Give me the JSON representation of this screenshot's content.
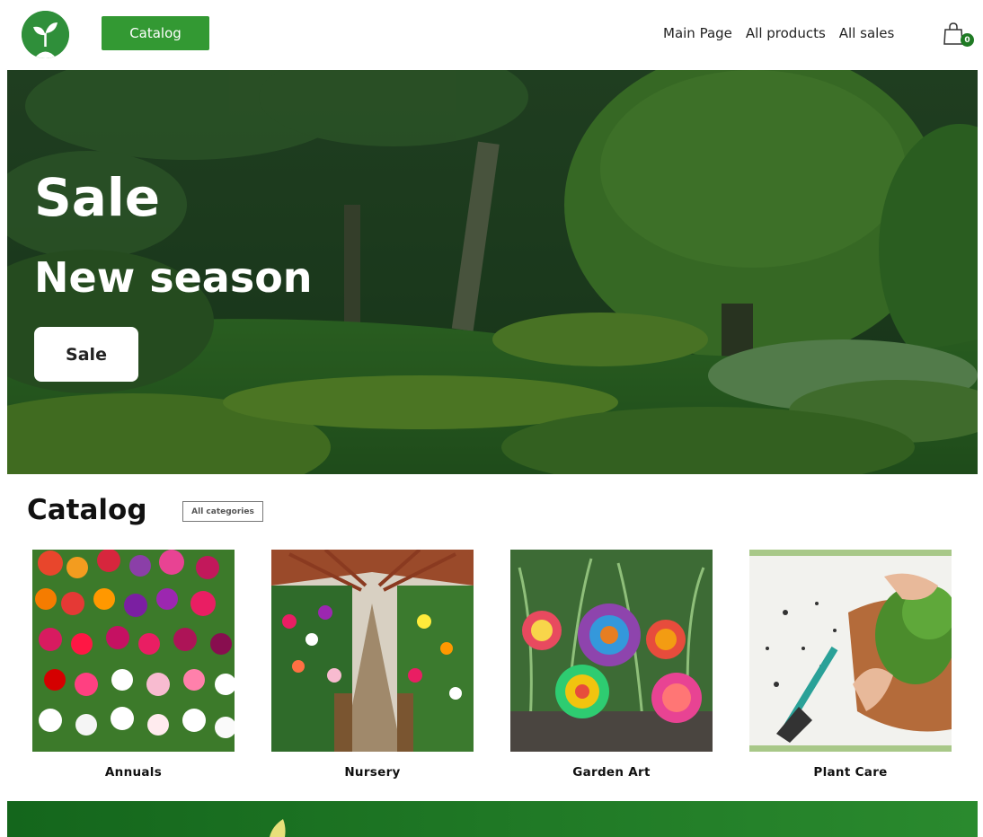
{
  "header": {
    "logo_icon": "sprout-icon",
    "catalog_button": "Catalog",
    "nav": [
      "Main Page",
      "All products",
      "All sales"
    ],
    "cart_icon": "shopping-bag-icon",
    "cart_count": "0"
  },
  "hero": {
    "title": "Sale",
    "subtitle": "New season",
    "button": "Sale"
  },
  "catalog": {
    "title": "Catalog",
    "all_categories": "All categories",
    "items": [
      {
        "label": "Annuals"
      },
      {
        "label": "Nursery"
      },
      {
        "label": "Garden Art"
      },
      {
        "label": "Plant Care"
      }
    ]
  },
  "colors": {
    "accent": "#339933",
    "dark_green": "#1f7a24",
    "banner_start": "#14661c",
    "banner_end": "#2a8a2e"
  }
}
